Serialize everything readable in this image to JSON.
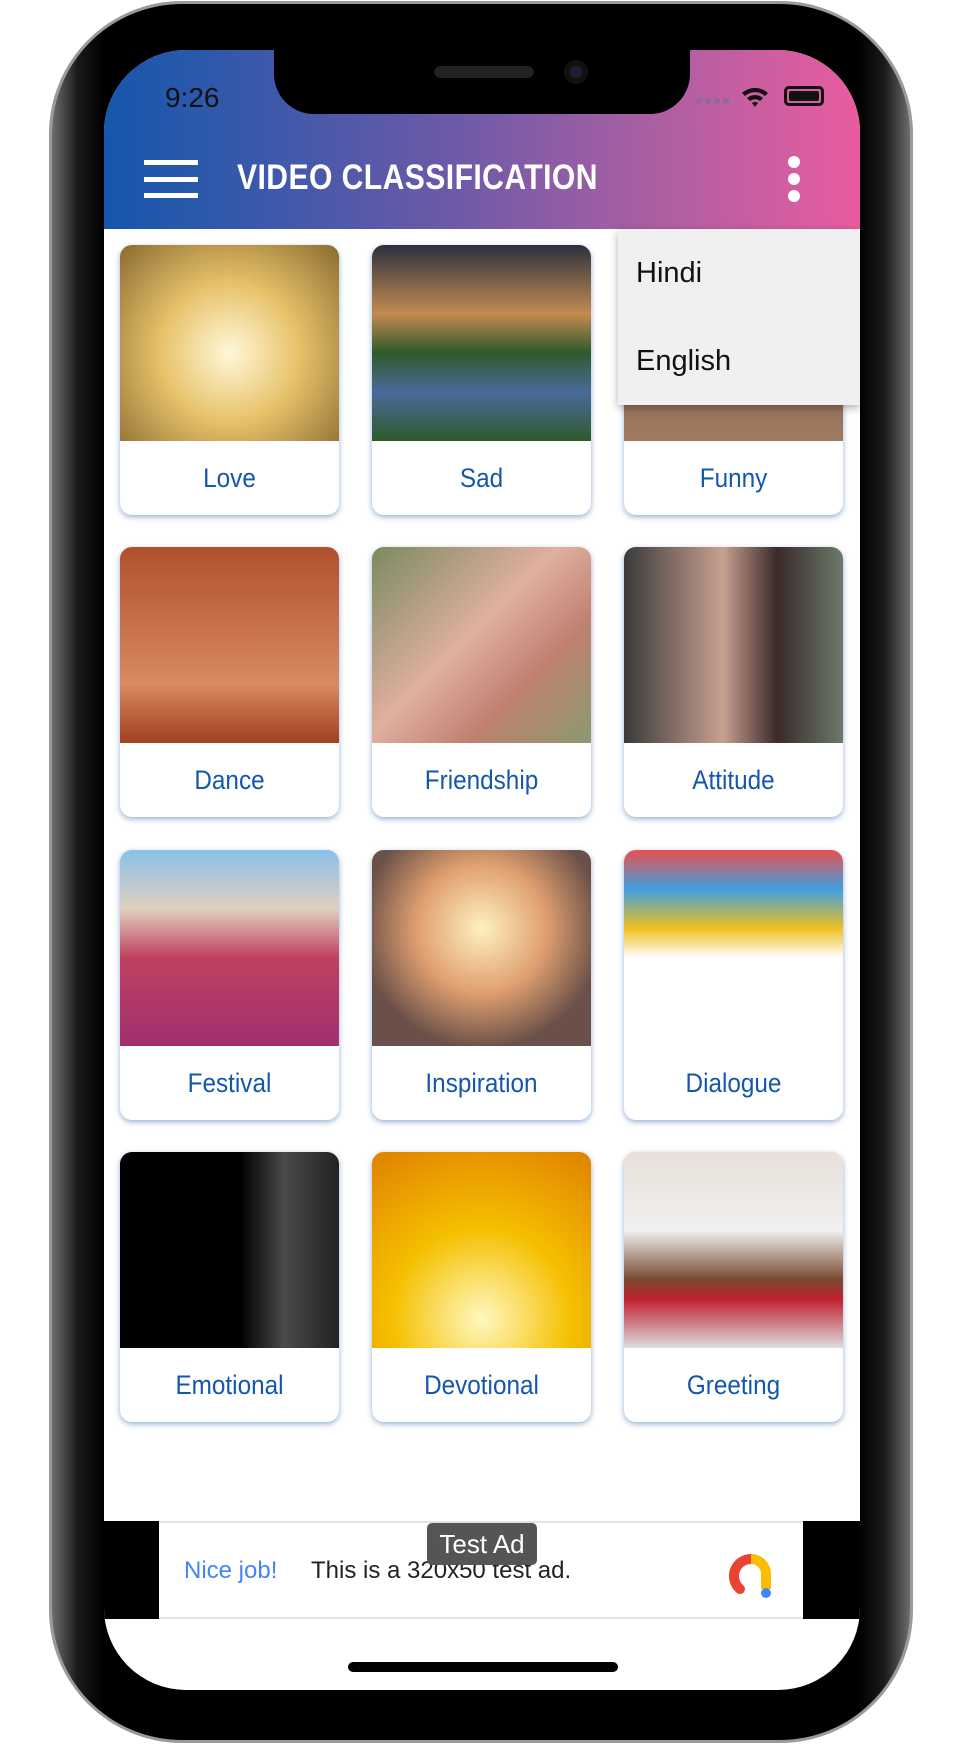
{
  "status_bar": {
    "time": "9:26"
  },
  "app_bar": {
    "title": "VIDEO CLASSIFICATION",
    "menu_icon": "hamburger-icon",
    "overflow_icon": "kebab-icon",
    "gradient": [
      "#1457ac",
      "#e85c9f"
    ]
  },
  "overflow_menu": {
    "items": [
      {
        "label": "Hindi"
      },
      {
        "label": "English"
      }
    ]
  },
  "categories": [
    {
      "label": "Love"
    },
    {
      "label": "Sad"
    },
    {
      "label": "Funny"
    },
    {
      "label": "Dance"
    },
    {
      "label": "Friendship"
    },
    {
      "label": "Attitude"
    },
    {
      "label": "Festival"
    },
    {
      "label": "Inspiration"
    },
    {
      "label": "Dialogue"
    },
    {
      "label": "Emotional"
    },
    {
      "label": "Devotional"
    },
    {
      "label": "Greeting"
    }
  ],
  "ad": {
    "badge": "Test Ad",
    "headline": "Nice job!",
    "text": "This is a 320x50 test ad."
  }
}
